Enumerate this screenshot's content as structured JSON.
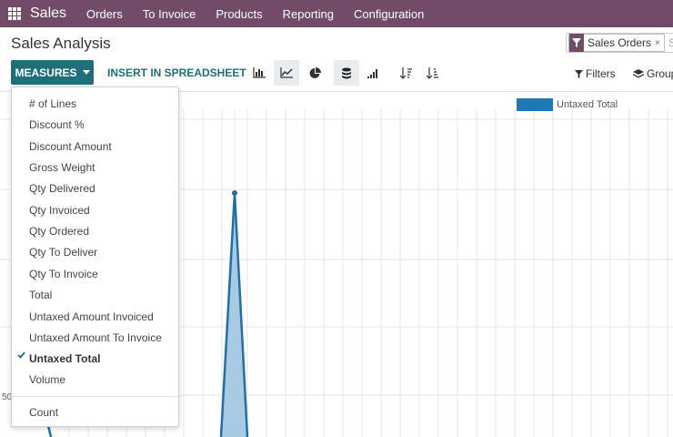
{
  "navbar": {
    "brand": "Sales",
    "menu": [
      "Orders",
      "To Invoice",
      "Products",
      "Reporting",
      "Configuration"
    ]
  },
  "page": {
    "title": "Sales Analysis"
  },
  "search": {
    "facet": "Sales Orders",
    "facet_close": "×",
    "placeholder": "Se"
  },
  "toolbar": {
    "measures_label": "MEASURES",
    "insert_label": "INSERT IN SPREADSHEET",
    "views": [
      "bar-chart-icon",
      "line-chart-icon",
      "pie-chart-icon",
      "stacked-icon",
      "cumulative-icon",
      "sort-desc-icon",
      "sort-asc-icon"
    ],
    "active_views": [
      "line-chart-icon",
      "stacked-icon"
    ],
    "filters_label": "Filters",
    "groupby_label": "Group"
  },
  "measures_menu": {
    "items": [
      "# of Lines",
      "Discount %",
      "Discount Amount",
      "Gross Weight",
      "Qty Delivered",
      "Qty Invoiced",
      "Qty Ordered",
      "Qty To Deliver",
      "Qty To Invoice",
      "Total",
      "Untaxed Amount Invoiced",
      "Untaxed Amount To Invoice",
      "Untaxed Total",
      "Volume"
    ],
    "checked": "Untaxed Total",
    "count_label": "Count"
  },
  "chart": {
    "legend": "Untaxed Total",
    "y_tick_partial": "50",
    "color": "#1f77b4"
  },
  "colors": {
    "brand": "#714B67",
    "accent": "#1F6F7A"
  }
}
